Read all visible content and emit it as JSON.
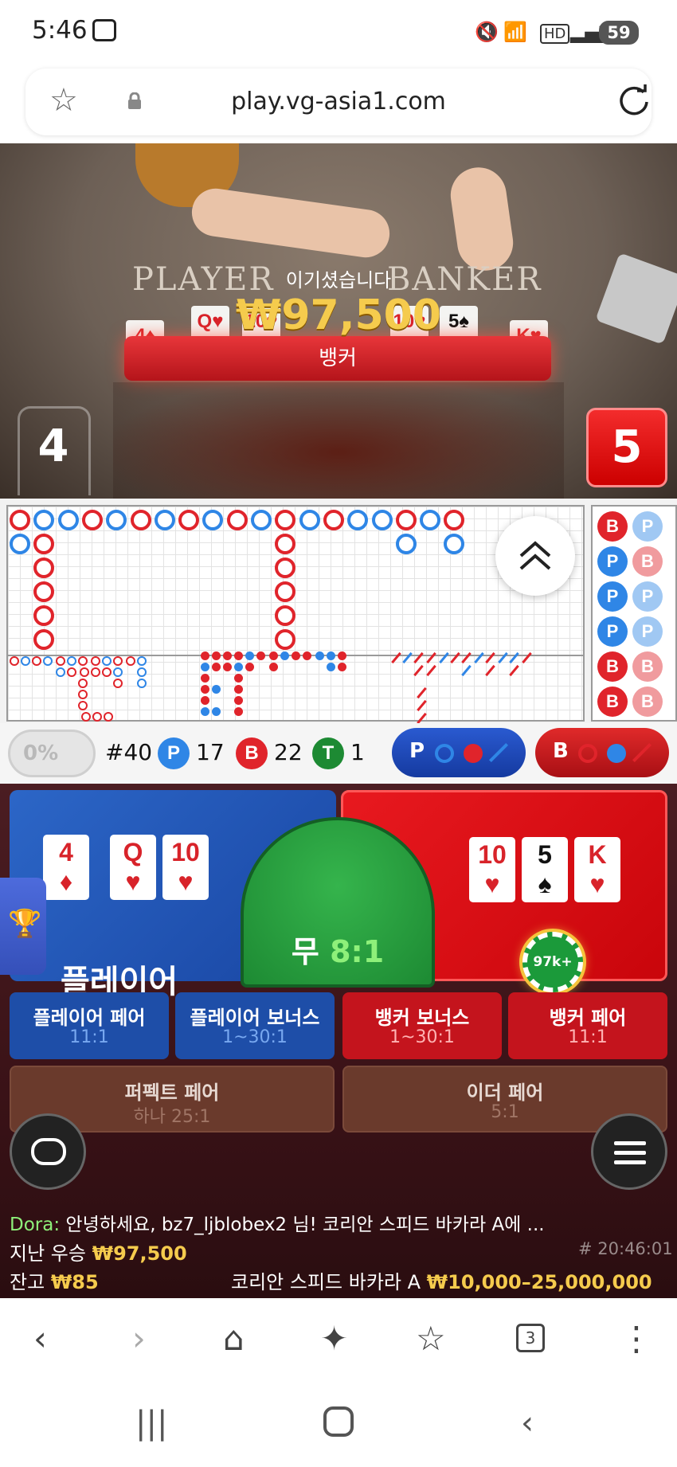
{
  "status": {
    "time": "5:46",
    "battery": "59"
  },
  "browser": {
    "url": "play.vg-asia1.com",
    "tab_count": "3"
  },
  "video": {
    "player_label": "PLAYER",
    "banker_label": "BANKER",
    "player_cards": [
      {
        "rank": "4",
        "suit": "♦",
        "color": "red"
      },
      {
        "rank": "Q",
        "suit": "♥",
        "color": "red"
      },
      {
        "rank": "10",
        "suit": "♥",
        "color": "red"
      }
    ],
    "banker_cards": [
      {
        "rank": "10",
        "suit": "♥",
        "color": "red"
      },
      {
        "rank": "5",
        "suit": "♠",
        "color": "black"
      },
      {
        "rank": "K",
        "suit": "♥",
        "color": "red"
      }
    ],
    "result": "뱅커",
    "win_message": "이기셨습니다",
    "win_amount": "₩97,500",
    "player_score": "4",
    "banker_score": "5"
  },
  "stats": {
    "percent": "0%",
    "round": "#40",
    "player_count": "17",
    "banker_count": "22",
    "tie_count": "1",
    "p_badge": "P",
    "b_badge": "B",
    "t_badge": "T",
    "predict_player": "P",
    "predict_banker": "B"
  },
  "bets": {
    "player": "플레이어",
    "tie": "무",
    "tie_odds": "8:1",
    "chip": "97k+",
    "player_pair": {
      "label": "플레이어 페어",
      "odds": "11:1"
    },
    "player_bonus": {
      "label": "플레이어 보너스",
      "odds": "1~30:1"
    },
    "banker_bonus": {
      "label": "뱅커 보너스",
      "odds": "1~30:1"
    },
    "banker_pair": {
      "label": "뱅커 페어",
      "odds": "11:1"
    },
    "perfect_pair": {
      "label": "퍼펙트 페어",
      "odds": "하나 25:1"
    },
    "either_pair": {
      "label": "이더 페어",
      "odds": "5:1"
    }
  },
  "chat": {
    "name": "Dora:",
    "message": "안녕하세요, bz7_ljblobex2 님! 코리안 스피드 바카라 A에 ...",
    "last_win_label": "지난 우승",
    "last_win_amount": "₩97,500",
    "round_time": "# 20:46:01",
    "balance_label": "잔고",
    "balance_amount": "₩85",
    "table_name": "코리안 스피드 바카라 A",
    "table_limits": "₩10,000–25,000,000"
  },
  "colors": {
    "player": "#2f86e6",
    "banker": "#e0242b",
    "tie": "#1d8a33",
    "gold": "#f5cb4d"
  }
}
